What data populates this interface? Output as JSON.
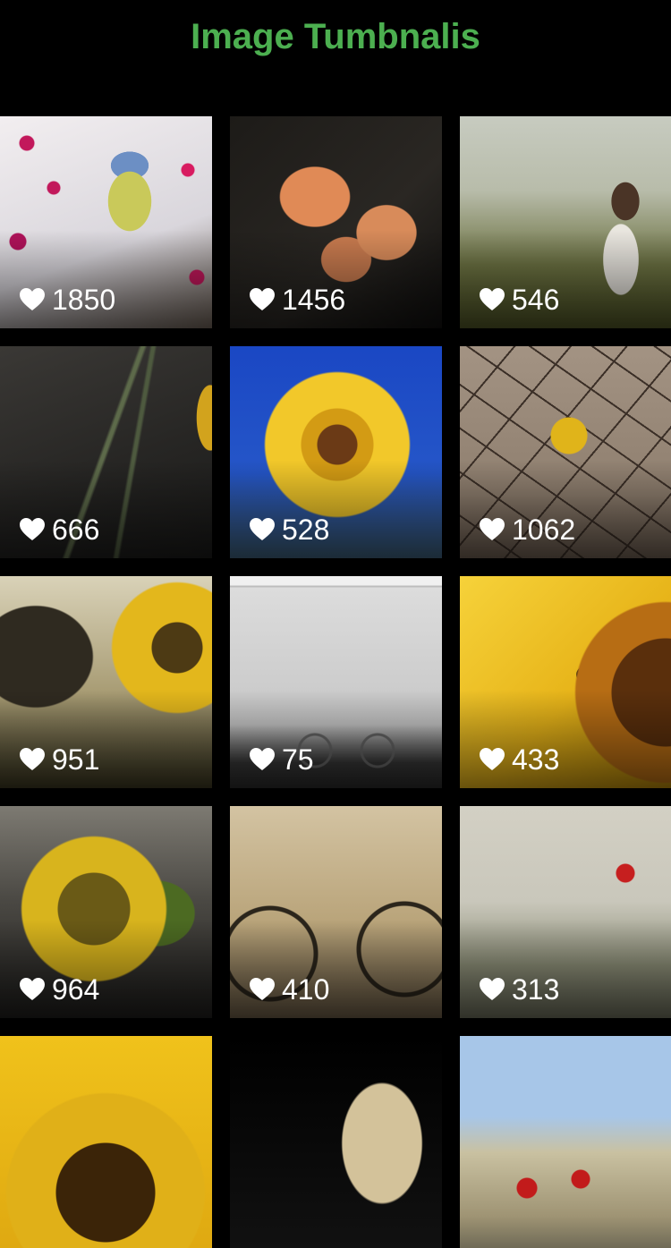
{
  "header": {
    "title": "Image Tumbnalis",
    "title_color": "#4caf50"
  },
  "grid": {
    "columns": 3,
    "tiles": [
      {
        "label": "bird",
        "likes": "1850"
      },
      {
        "label": "roses",
        "likes": "1456"
      },
      {
        "label": "woman-in-field",
        "likes": "546"
      },
      {
        "label": "grass",
        "likes": "666"
      },
      {
        "label": "sunflower-blue-sky",
        "likes": "528"
      },
      {
        "label": "flower-in-cracked-earth",
        "likes": "1062"
      },
      {
        "label": "sunflower-field",
        "likes": "951"
      },
      {
        "label": "bicycle-wall",
        "likes": "75"
      },
      {
        "label": "bee-on-sunflower",
        "likes": "433"
      },
      {
        "label": "sunflower-dark",
        "likes": "964"
      },
      {
        "label": "bicycle-field",
        "likes": "410"
      },
      {
        "label": "poppy-field",
        "likes": "313"
      },
      {
        "label": "sunflower-close",
        "likes": ""
      },
      {
        "label": "hair",
        "likes": ""
      },
      {
        "label": "wheat-poppies",
        "likes": ""
      }
    ]
  },
  "icons": {
    "like": "heart-icon"
  },
  "colors": {
    "background": "#000000",
    "text": "#ffffff"
  }
}
